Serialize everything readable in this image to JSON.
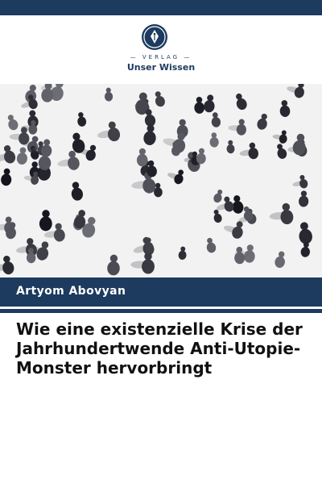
{
  "cover": {
    "publisher": {
      "series": "VERLAG",
      "name": "Unser Wissen",
      "logo_icon": "fountain-pen-nib-icon"
    },
    "author": "Artyom Abovyan",
    "title": "Wie eine existenzielle Krise der Jahrhundertwende Anti-Utopie-Monster hervorbringt",
    "image_description_icon": "crowd-of-people-photo",
    "colors": {
      "brand_navy": "#1d3a5f",
      "background": "#ffffff",
      "title_text": "#111111"
    }
  }
}
